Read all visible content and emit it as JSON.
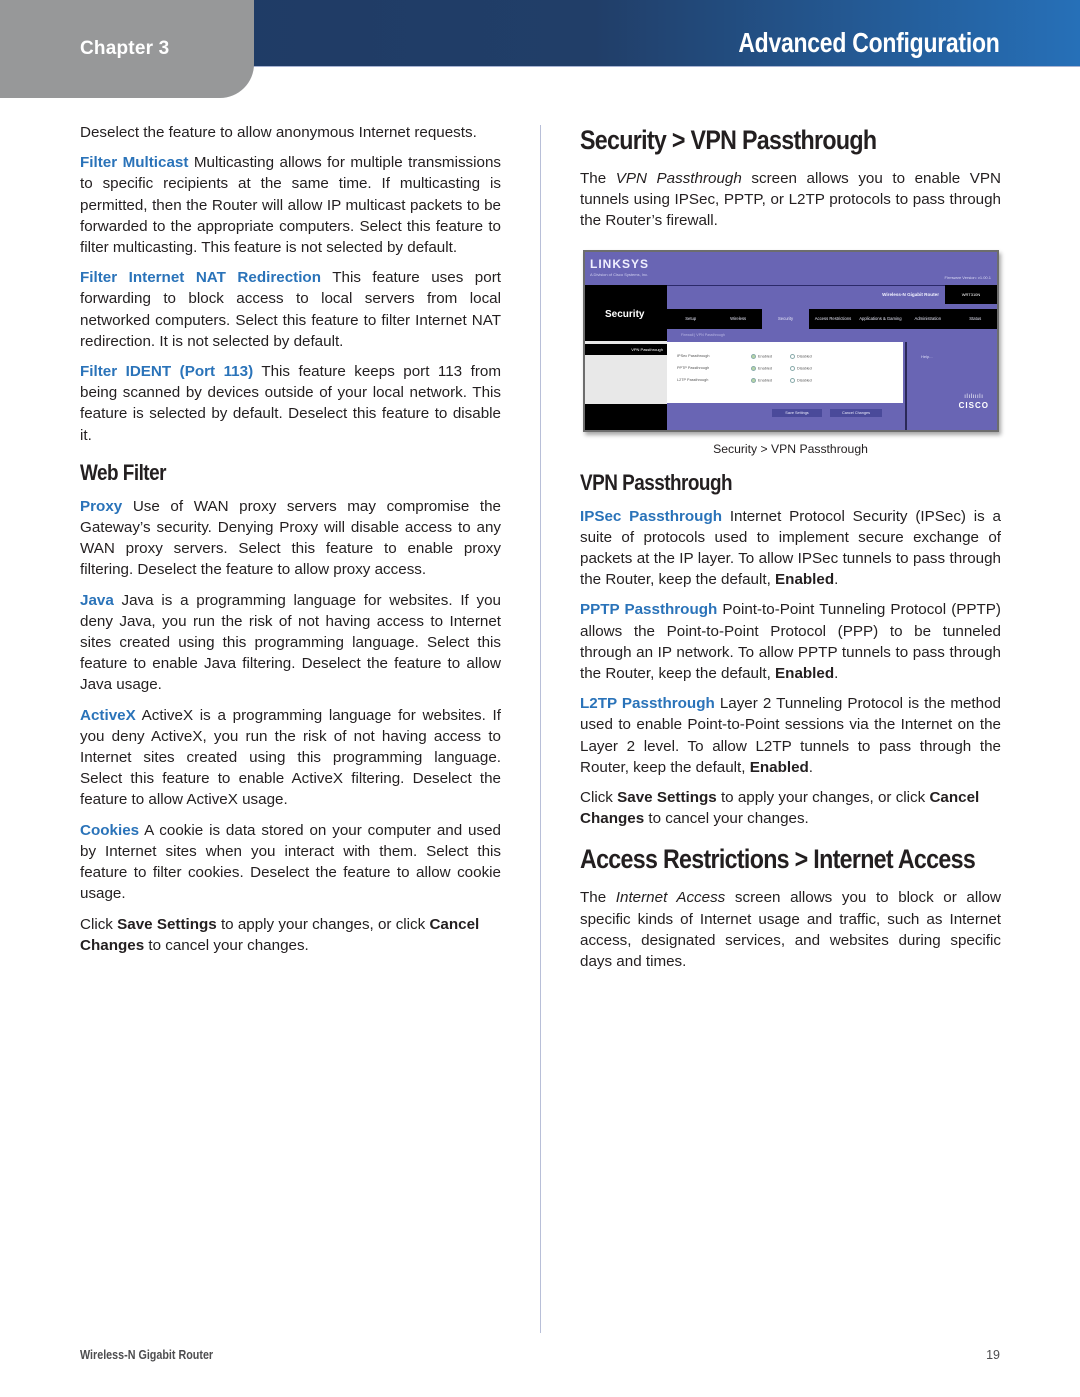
{
  "header": {
    "chapter": "Chapter 3",
    "title": "Advanced Configuration"
  },
  "left_column": {
    "intro": "Deselect the feature to allow anonymous Internet requests.",
    "filter_multicast": {
      "term": "Filter Multicast",
      "text": " Multicasting allows for multiple transmissions to specific recipients at the same time. If multicasting is permitted, then the Router will allow IP multicast packets to be forwarded to the appropriate computers. Select this feature to filter multicasting. This feature is not selected by default."
    },
    "filter_nat": {
      "term": "Filter Internet NAT Redirection",
      "text": "  This feature uses port forwarding to block access to local servers from local networked computers. Select this feature to filter Internet NAT redirection. It is not selected by default."
    },
    "filter_ident": {
      "term": "Filter IDENT (Port 113)",
      "text": "  This feature keeps port 113 from being scanned by devices outside of your local network. This feature is selected by default. Deselect this feature to disable it."
    },
    "web_filter_heading": "Web Filter",
    "proxy": {
      "term": "Proxy",
      "text": "  Use of WAN proxy servers may compromise the Gateway’s security. Denying Proxy will disable access to any WAN proxy servers. Select this feature to enable proxy filtering. Deselect the feature to allow proxy access."
    },
    "java": {
      "term": "Java",
      "text": "  Java is a programming language for websites. If you deny Java, you run the risk of not having access to Internet sites created using this programming language. Select this feature to enable Java filtering. Deselect the feature to allow Java usage."
    },
    "activex": {
      "term": "ActiveX",
      "text": "  ActiveX is a programming language for websites. If you deny ActiveX, you run the risk of not having access to Internet sites created using this programming language. Select this feature to enable ActiveX filtering. Deselect the feature to allow ActiveX usage."
    },
    "cookies": {
      "term": "Cookies",
      "text": "  A cookie is data stored on your computer and used by Internet sites when you interact with them. Select this feature to filter cookies. Deselect the feature to allow cookie usage."
    },
    "save_note": {
      "pre": "Click ",
      "save": "Save Settings",
      "mid": " to apply your changes, or click ",
      "cancel": "Cancel Changes",
      "post": " to cancel your changes."
    }
  },
  "right_column": {
    "vpn_heading": "Security > VPN Passthrough",
    "vpn_intro": {
      "pre": "The ",
      "italic": "VPN Passthrough",
      "post": " screen allows you to enable VPN tunnels using IPSec, PPTP, or L2TP protocols to pass through the Router’s firewall."
    },
    "figure": {
      "logo": "LINKSYS",
      "logo_sub": "A Division of Cisco Systems, Inc.",
      "firmware": "Firmware Version: v1.00.1",
      "section_title": "Security",
      "product": "Wireless-N Gigabit Router",
      "model": "WRT310N",
      "tabs": [
        "Setup",
        "Wireless",
        "Security",
        "Access Restrictions",
        "Applications & Gaming",
        "Administration",
        "Status"
      ],
      "active_tab": "Security",
      "subtabs": "Firewall   |   VPN Passthrough",
      "side_label": "VPN Passthrough",
      "rows": [
        {
          "label": "IPSec Passthrough",
          "enabled": "Enabled",
          "disabled": "Disabled"
        },
        {
          "label": "PPTP Passthrough",
          "enabled": "Enabled",
          "disabled": "Disabled"
        },
        {
          "label": "L2TP Passthrough",
          "enabled": "Enabled",
          "disabled": "Disabled"
        }
      ],
      "help": "Help...",
      "save_button": "Save Settings",
      "cancel_button": "Cancel Changes",
      "cisco_word": "CISCO",
      "caption": "Security > VPN Passthrough"
    },
    "vpn_sub_heading": "VPN Passthrough",
    "ipsec": {
      "term": "IPSec Passthrough",
      "text": "  Internet Protocol Security (IPSec) is a suite of protocols used to implement secure exchange of packets at the IP layer. To allow IPSec tunnels to pass through the Router, keep the default, ",
      "bold": "Enabled",
      "end": "."
    },
    "pptp": {
      "term": "PPTP Passthrough",
      "text": " Point-to-Point Tunneling Protocol (PPTP) allows the Point-to-Point Protocol (PPP) to be tunneled through an IP network. To allow PPTP tunnels to pass through the Router, keep the default, ",
      "bold": "Enabled",
      "end": "."
    },
    "l2tp": {
      "term": "L2TP Passthrough",
      "text": " Layer 2 Tunneling Protocol is the method used to enable Point-to-Point sessions via the Internet on the Layer 2 level. To allow L2TP tunnels to pass through the Router, keep the default, ",
      "bold": "Enabled",
      "end": "."
    },
    "save_note": {
      "pre": "Click ",
      "save": "Save Settings",
      "mid": " to apply your changes, or click ",
      "cancel": "Cancel Changes",
      "post": " to cancel your changes."
    },
    "access_heading": "Access Restrictions > Internet Access",
    "access_intro": {
      "pre": "The ",
      "italic": "Internet Access",
      "post": " screen allows you to block or allow specific kinds of Internet usage and traffic, such as Internet access, designated services, and websites during specific days and times."
    }
  },
  "footer": {
    "product": "Wireless-N Gigabit Router",
    "page": "19"
  },
  "colors": {
    "accent_term": "#2a73b9",
    "header_dark": "#1e3a64",
    "header_light": "#2670b8",
    "chapter_tab": "#979899"
  }
}
